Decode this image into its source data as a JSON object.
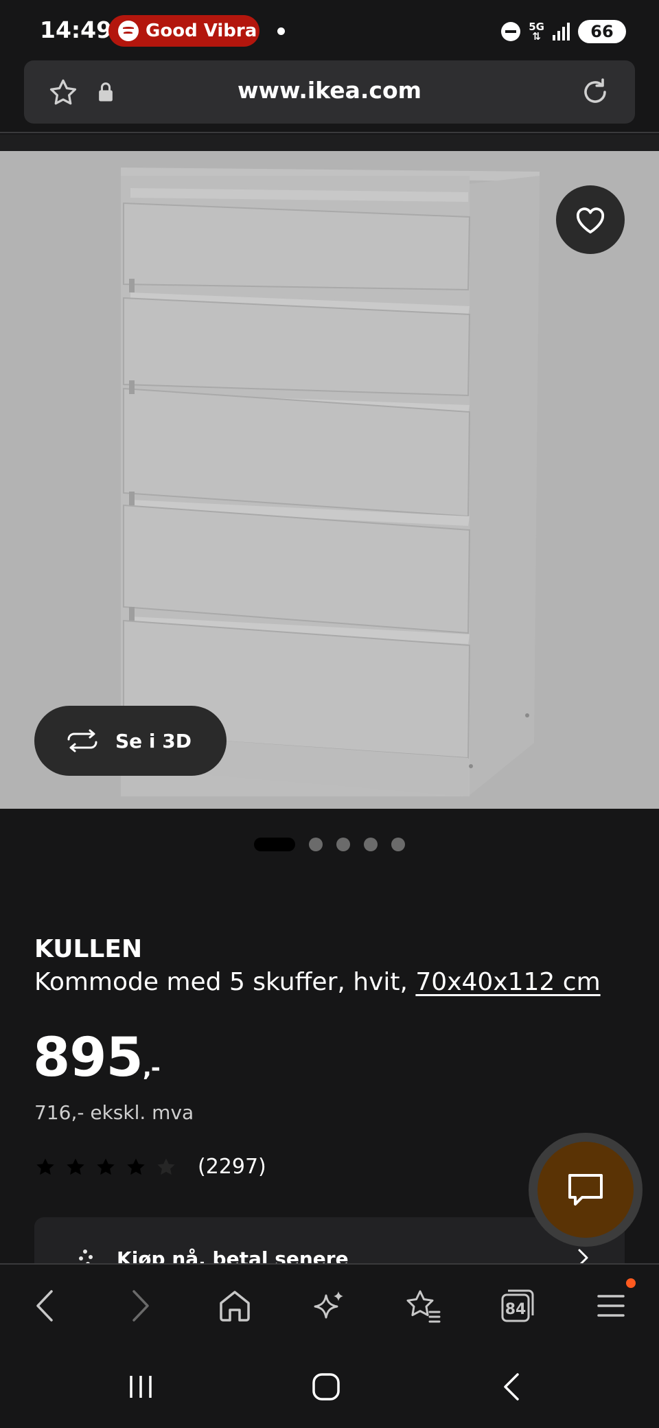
{
  "status_bar": {
    "time": "14:49",
    "media_pill": "Good Vibra",
    "network": "5G",
    "battery": "66",
    "colors": {
      "media_pill_bg": "#b3160d"
    }
  },
  "browser": {
    "url": "www.ikea.com",
    "tab_count": "84"
  },
  "product": {
    "view_3d_label": "Se i 3D",
    "image_count": 5,
    "active_image_index": 0,
    "brand": "KULLEN",
    "description": "Kommode med 5 skuffer, hvit,",
    "dimensions": "70x40x112 cm",
    "price": "895",
    "price_suffix": ",-",
    "price_ex_vat": "716,- ekskl. mva",
    "rating_value": 4,
    "rating_max": 5,
    "rating_count": "(2297)"
  },
  "pay_later": {
    "label": "Kjøp nå, betal senere"
  },
  "icons": [
    "star-icon",
    "lock-icon",
    "reload-icon",
    "heart-icon",
    "rotate-3d-icon",
    "chat-icon",
    "back-icon",
    "forward-icon",
    "home-icon",
    "sparkle-icon",
    "bookmarks-icon",
    "tabs-icon",
    "menu-icon",
    "recents-icon",
    "home-nav-icon",
    "back-nav-icon"
  ]
}
